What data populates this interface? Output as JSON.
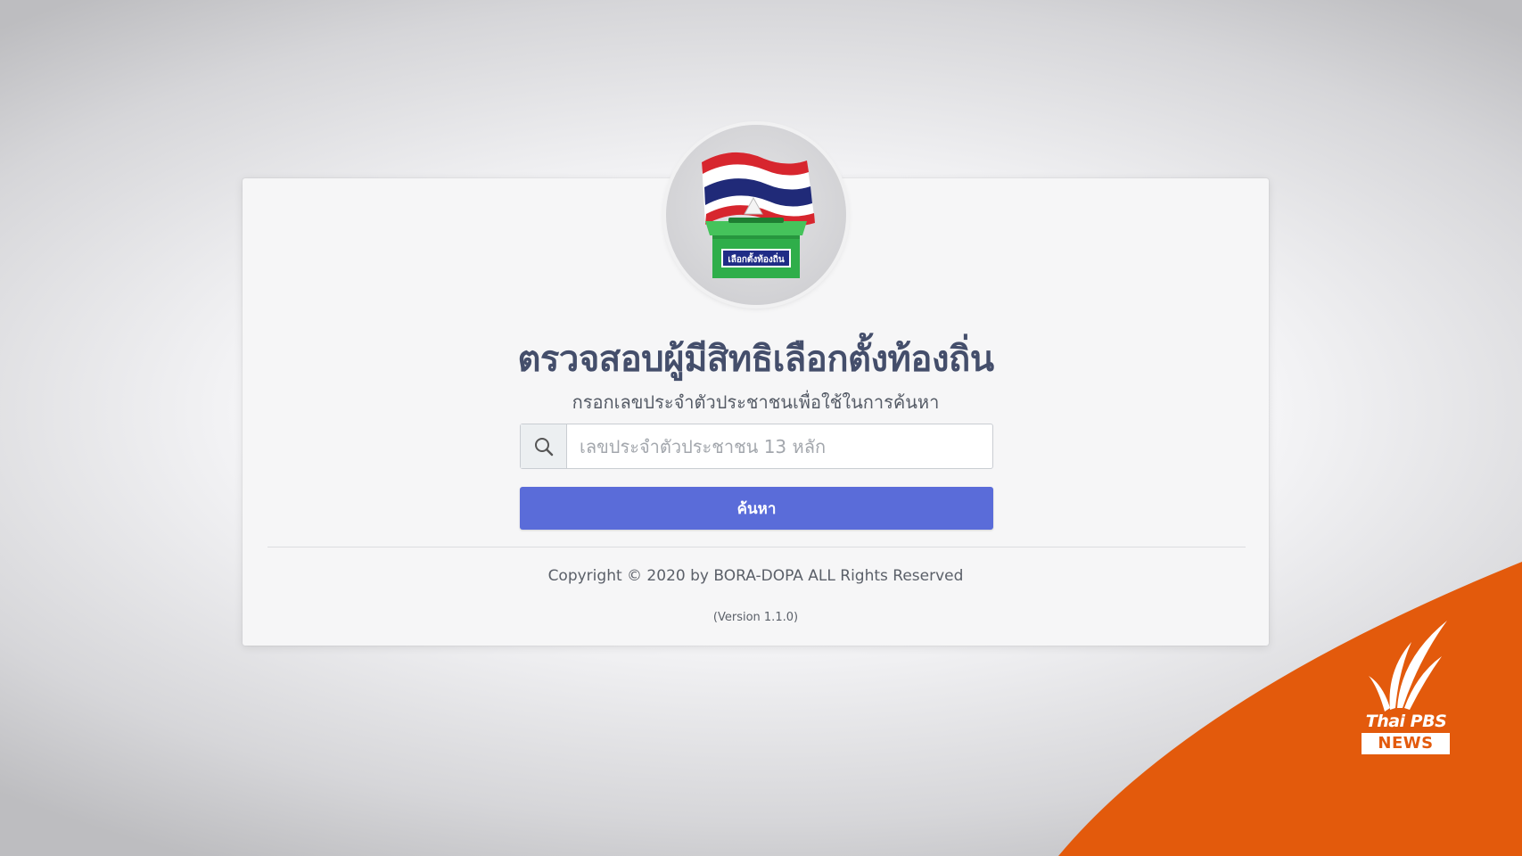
{
  "logo": {
    "badge_text": "เลือกตั้งท้องถิ่น",
    "icon": "thai-flag-ballot-box-icon"
  },
  "header": {
    "title": "ตรวจสอบผู้มีสิทธิเลือกตั้งท้องถิ่น",
    "subtitle": "กรอกเลขประจำตัวประชาชนเพื่อใช้ในการค้นหา"
  },
  "search": {
    "icon": "search-icon",
    "placeholder": "เลขประจำตัวประชาชน 13 หลัก",
    "value": "",
    "button_label": "ค้นหา"
  },
  "footer": {
    "copyright": "Copyright © 2020 by BORA-DOPA ALL Rights Reserved",
    "version": "(Version 1.1.0)"
  },
  "watermark": {
    "brand": "Thai PBS",
    "sub": "NEWS",
    "color": "#e35a0c"
  },
  "colors": {
    "accent": "#5a6cd9",
    "title": "#444e6b",
    "ballot_box": "#2fae4a"
  }
}
